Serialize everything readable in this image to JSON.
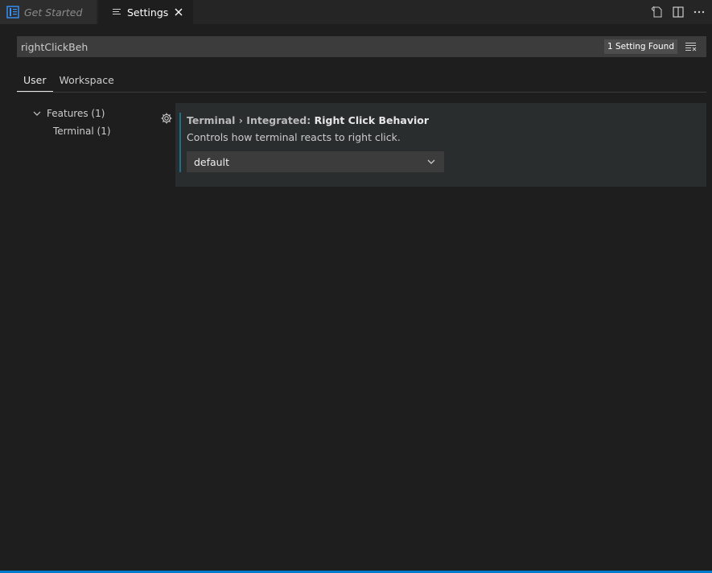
{
  "tabs": [
    {
      "label": "Get Started",
      "icon": "vscode-logo-icon",
      "active": false
    },
    {
      "label": "Settings",
      "icon": "lines-icon",
      "active": true
    }
  ],
  "editor_actions": [
    "open-json-icon",
    "split-editor-icon",
    "more-icon"
  ],
  "search": {
    "value": "rightClickBeh",
    "count": "1 Setting Found"
  },
  "scope_tabs": {
    "user": "User",
    "workspace": "Workspace"
  },
  "toc": {
    "features": "Features (1)",
    "terminal": "Terminal (1)"
  },
  "setting": {
    "category": "Terminal › Integrated: ",
    "name": "Right Click Behavior",
    "description": "Controls how terminal reacts to right click.",
    "value": "default"
  },
  "colors": {
    "accent": "#007acc",
    "focus": "#1b6f8b",
    "background": "#1e1e1e"
  }
}
